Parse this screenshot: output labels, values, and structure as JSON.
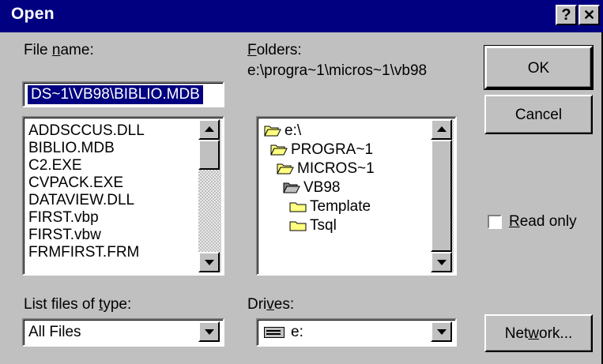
{
  "window": {
    "title": "Open",
    "help_glyph": "?",
    "close_glyph": "✕"
  },
  "file_name": {
    "label_pre": "File ",
    "label_accel": "n",
    "label_post": "ame:",
    "value": "DS~1\\VB98\\BIBLIO.MDB"
  },
  "files": [
    "ADDSCCUS.DLL",
    "BIBLIO.MDB",
    "C2.EXE",
    "CVPACK.EXE",
    "DATAVIEW.DLL",
    "FIRST.vbp",
    "FIRST.vbw",
    "FRMFIRST.FRM"
  ],
  "folders": {
    "label_accel": "F",
    "label_post": "olders:",
    "current_path": "e:\\progra~1\\micros~1\\vb98",
    "items": [
      {
        "name": "e:\\",
        "icon": "open-folder-icon"
      },
      {
        "name": "PROGRA~1",
        "icon": "open-folder-icon"
      },
      {
        "name": "MICROS~1",
        "icon": "open-folder-icon"
      },
      {
        "name": "VB98",
        "icon": "open-folder-selected-icon"
      },
      {
        "name": "Template",
        "icon": "closed-folder-icon"
      },
      {
        "name": "Tsql",
        "icon": "closed-folder-icon"
      }
    ]
  },
  "file_type": {
    "label_pre": "List files of ",
    "label_accel": "t",
    "label_post": "ype:",
    "value": "All Files"
  },
  "drives": {
    "label_pre": "Dri",
    "label_accel": "v",
    "label_post": "es:",
    "value": "e:",
    "icon": "drive-icon"
  },
  "buttons": {
    "ok": "OK",
    "cancel": "Cancel",
    "network_pre": "Net",
    "network_accel": "w",
    "network_post": "ork..."
  },
  "read_only": {
    "label_accel": "R",
    "label_post": "ead only",
    "checked": false
  },
  "colors": {
    "title_bar": "#000080",
    "dialog_face": "#c0c0c0",
    "selection": "#000080"
  }
}
